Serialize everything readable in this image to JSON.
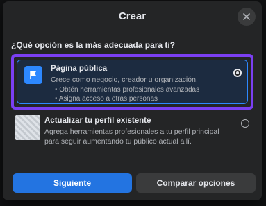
{
  "dialog": {
    "title": "Crear",
    "question": "¿Qué opción es la más adecuada para ti?"
  },
  "options": [
    {
      "title": "Página pública",
      "description": "Crece como negocio, creador u organización.",
      "bullets": [
        "Obtén herramientas profesionales avanzadas",
        "Asigna acceso a otras personas"
      ],
      "selected": true
    },
    {
      "title": "Actualizar tu perfil existente",
      "description": "Agrega herramientas profesionales a tu perfil principal para seguir aumentando tu público actual allí.",
      "selected": false
    }
  ],
  "footer": {
    "next_label": "Siguiente",
    "compare_label": "Comparar opciones"
  },
  "colors": {
    "accent": "#2374e1",
    "highlight": "#7b3ff2"
  }
}
